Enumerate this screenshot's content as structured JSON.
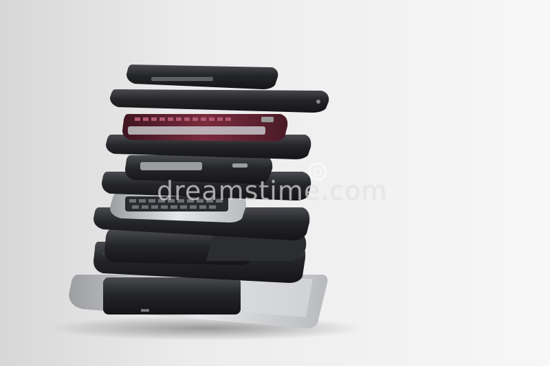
{
  "photo": {
    "subject": "stacked-phones",
    "watermark": "dreamstime.com"
  },
  "colors": {
    "background": "#eeeeee",
    "phone_dark": "#232427",
    "phone_mid": "#3a3b3f",
    "phone_red": "#5a1f2c",
    "silver": "#cfd0d2"
  }
}
